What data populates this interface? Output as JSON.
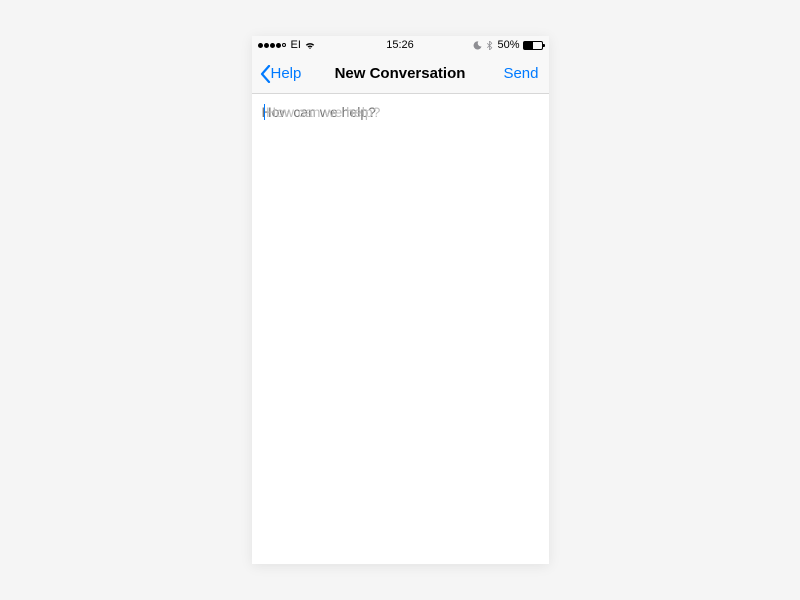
{
  "statusBar": {
    "carrier": "EI",
    "time": "15:26",
    "batteryPct": "50%"
  },
  "nav": {
    "backLabel": "Help",
    "title": "New Conversation",
    "sendLabel": "Send"
  },
  "compose": {
    "placeholder": "How can we help?"
  }
}
